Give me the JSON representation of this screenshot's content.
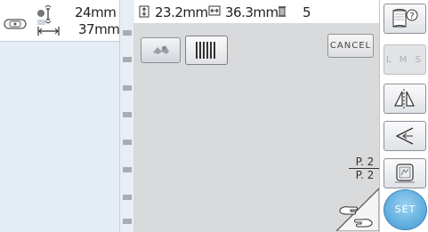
{
  "header": {
    "height_value": "24mm",
    "width_value": "37mm"
  },
  "top_info": {
    "size_h": "23.2mm",
    "size_w": "36.3mm",
    "color_count": "5"
  },
  "work_area": {
    "cancel_label": "CANCEL",
    "page_current": "P. 2",
    "page_total": "P. 2"
  },
  "right_panel": {
    "lms_label": "L M S",
    "set_label": "SET"
  },
  "icons": [
    "hoop-size-icon",
    "needle-position-icon",
    "vertical-size-icon",
    "horizontal-size-icon",
    "thread-spool-icon",
    "design-thumbnail-icon",
    "barcode-icon",
    "page-flip-icon",
    "help-icon",
    "mirror-icon",
    "rotate-icon",
    "frame-icon"
  ],
  "colors": {
    "set_button": "#5aa9dc",
    "work_area": "#d9dadb",
    "left_panel": "#e4ecf6"
  }
}
